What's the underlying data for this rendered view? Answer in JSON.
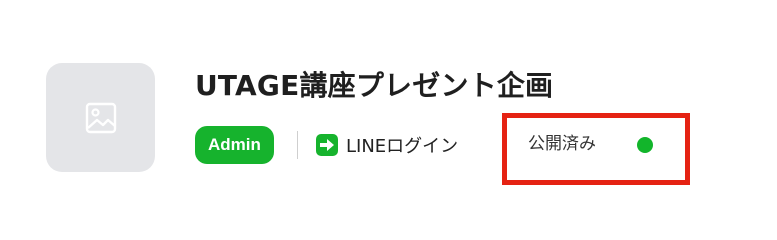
{
  "item": {
    "thumbnail_icon": "image-icon",
    "title": "UTAGE講座プレゼント企画",
    "role_badge": "Admin",
    "login_method_icon": "arrow-right-icon",
    "login_method": "LINEログイン",
    "status": "公開済み"
  },
  "colors": {
    "badge_green": "#16b32d",
    "status_green": "#12b52b",
    "highlight_red": "#e52213",
    "thumbnail_bg": "#e4e5e8"
  }
}
